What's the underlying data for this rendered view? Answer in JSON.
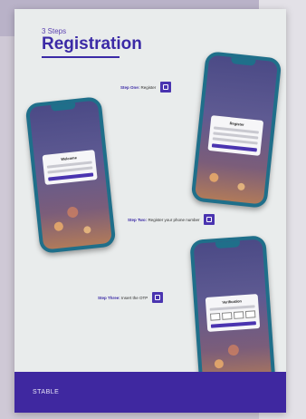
{
  "poster": {
    "steps_count": "3 Steps",
    "title": "Registration",
    "brand": "STABLE"
  },
  "steps": [
    {
      "title": "Step One:",
      "text": "Register"
    },
    {
      "title": "Step Two:",
      "text": "Register your phone number"
    },
    {
      "title": "Step Three:",
      "text": "Insert the OTP"
    }
  ],
  "screens": {
    "welcome": {
      "card_title": "Welcome"
    },
    "register": {
      "card_title": "Register"
    },
    "otp": {
      "card_title": "Verification"
    }
  },
  "colors": {
    "accent": "#3b2aa6",
    "footer": "#3f28a0",
    "phone": "#1f6f8a",
    "poster": "#e9ecec"
  }
}
